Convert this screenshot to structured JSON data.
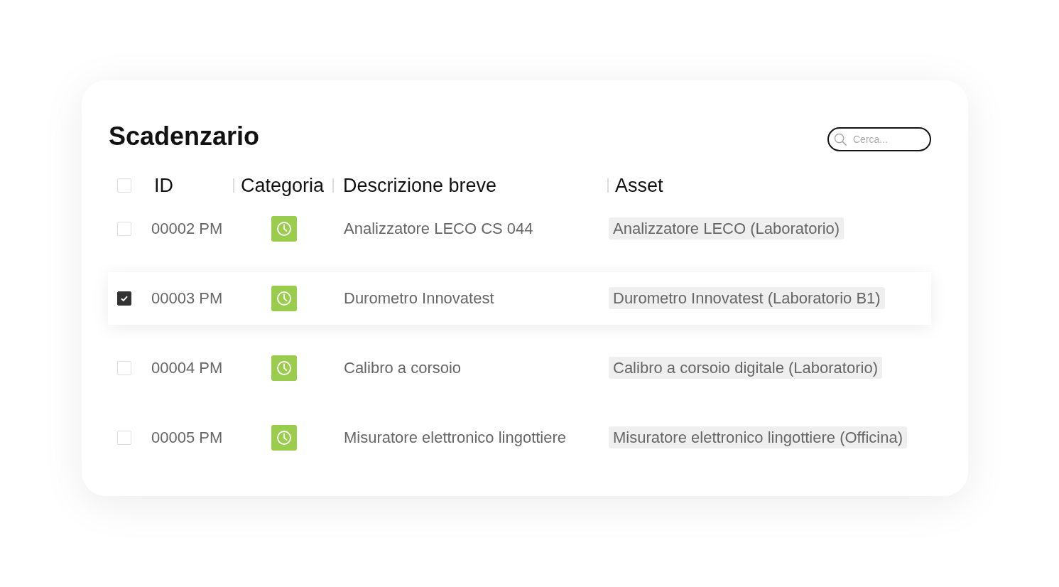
{
  "title": "Scadenzario",
  "search": {
    "placeholder": "Cerca..."
  },
  "table": {
    "select_all": {
      "checked": false
    },
    "columns": [
      "ID",
      "Categoria",
      "Descrizione breve",
      "Asset"
    ],
    "rows": [
      {
        "id": "00002 PM",
        "description": "Analizzatore LECO CS 044",
        "asset": "Analizzatore LECO (Laboratorio)",
        "checked": false
      },
      {
        "id": "00003 PM",
        "description": "Durometro Innovatest",
        "asset": "Durometro Innovatest (Laboratorio B1)",
        "checked": true
      },
      {
        "id": "00004 PM",
        "description": "Calibro a corsoio",
        "asset": "Calibro a corsoio digitale (Laboratorio)",
        "checked": false
      },
      {
        "id": "00005 PM",
        "description": "Misuratore elettronico lingottiere",
        "asset": "Misuratore elettronico lingottiere (Officina)",
        "checked": false
      }
    ]
  }
}
